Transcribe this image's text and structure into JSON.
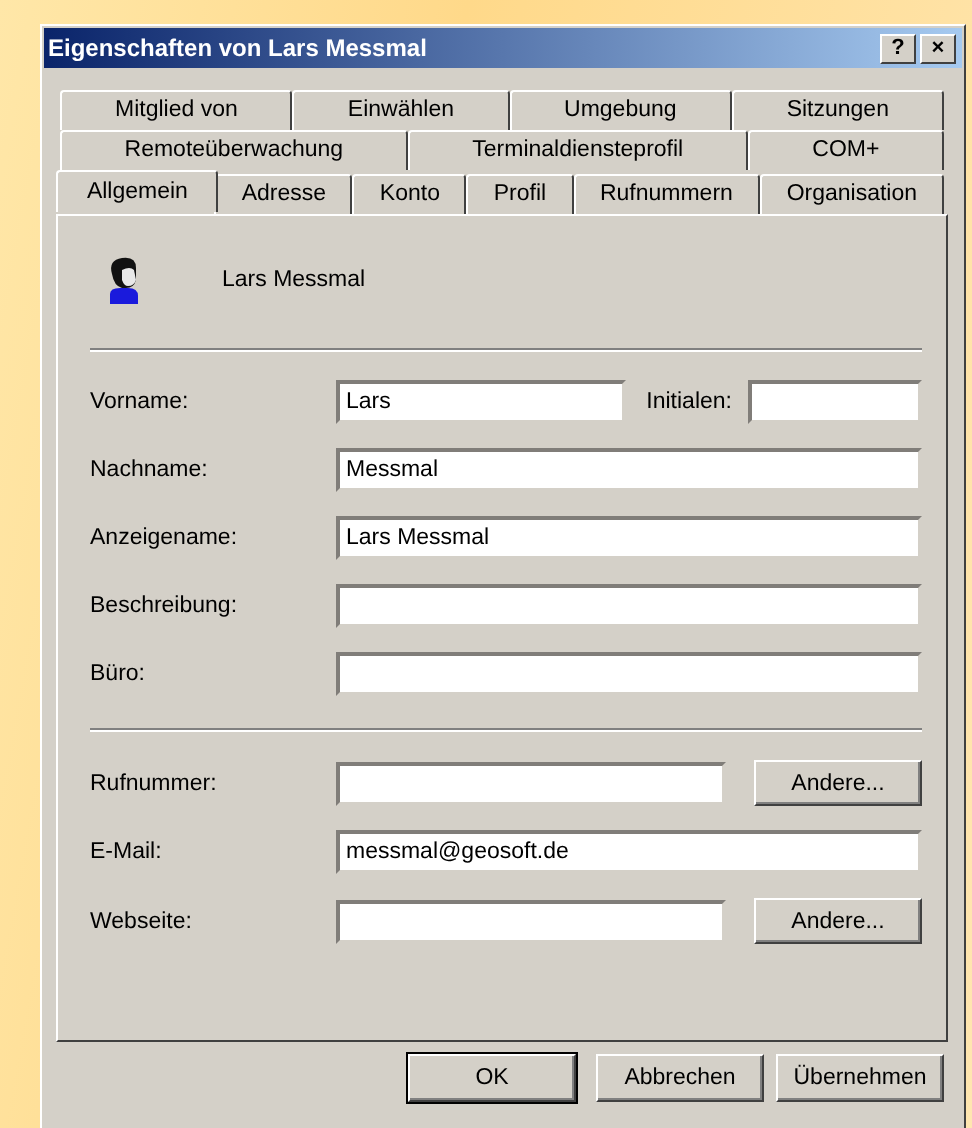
{
  "window": {
    "title": "Eigenschaften von Lars Messmal",
    "title_buttons": [
      "?",
      "×"
    ]
  },
  "tab_rows": [
    [
      {
        "label": "Mitglied von",
        "selected": false
      },
      {
        "label": "Einwählen",
        "selected": false
      },
      {
        "label": "Umgebung",
        "selected": false
      },
      {
        "label": "Sitzungen",
        "selected": false
      }
    ],
    [
      {
        "label": "Remoteüberwachung",
        "selected": false
      },
      {
        "label": "Terminaldiensteprofil",
        "selected": false
      },
      {
        "label": "COM+",
        "selected": false
      }
    ],
    [
      {
        "label": "Allgemein",
        "selected": true
      },
      {
        "label": "Adresse",
        "selected": false
      },
      {
        "label": "Konto",
        "selected": false
      },
      {
        "label": "Profil",
        "selected": false
      },
      {
        "label": "Rufnummern",
        "selected": false
      },
      {
        "label": "Organisation",
        "selected": false
      }
    ]
  ],
  "user": {
    "name": "Lars Messmal"
  },
  "groups": [
    [
      {
        "label": "Vorname:",
        "value": "Lars",
        "extra": {
          "label": "Initialen:"
        }
      },
      {
        "label": "Nachname:",
        "value": "Messmal"
      },
      {
        "label": "Anzeigename:",
        "value": "Lars Messmal"
      },
      {
        "label": "Beschreibung:"
      },
      {
        "label": "Büro:"
      }
    ],
    [
      {
        "label": "Rufnummer:",
        "button": "Andere..."
      },
      {
        "label": "E-Mail:",
        "value": "messmal@geosoft.de"
      },
      {
        "label": "Webseite:",
        "button": "Andere..."
      }
    ]
  ],
  "buttons": [
    {
      "label": "OK",
      "default": true
    },
    {
      "label": "Abbrechen",
      "default": false
    },
    {
      "label": "Übernehmen",
      "default": false
    }
  ]
}
